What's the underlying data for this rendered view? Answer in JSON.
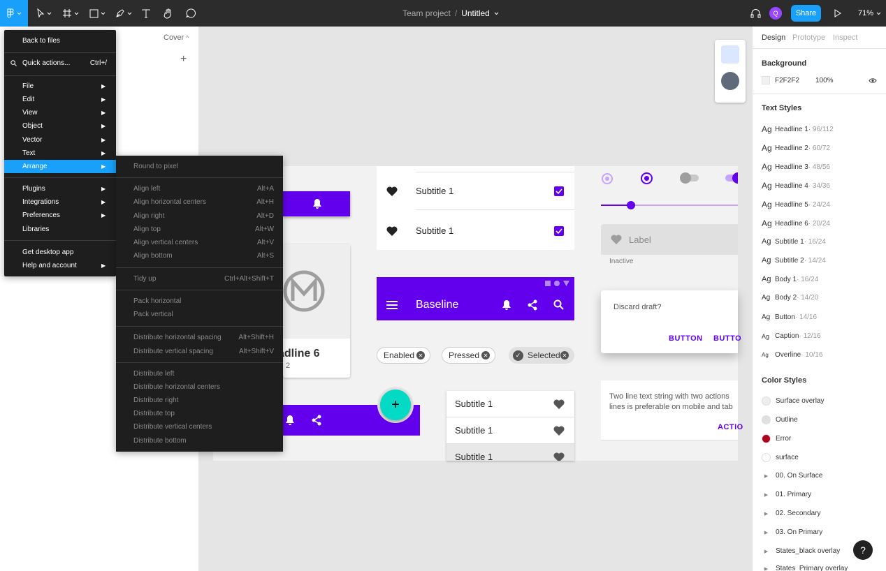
{
  "toolbar": {
    "project": "Team project",
    "separator": "/",
    "file_name": "Untitled",
    "share_label": "Share",
    "avatar_initial": "Q",
    "zoom": "71%",
    "accent": "#18a0fb"
  },
  "left_panel": {
    "page_name": "Cover",
    "add_label": "+"
  },
  "main_menu": {
    "items": [
      {
        "label": "Back to files"
      },
      {
        "label": "Quick actions...",
        "shortcut": "Ctrl+/"
      },
      {
        "label": "File"
      },
      {
        "label": "Edit"
      },
      {
        "label": "View"
      },
      {
        "label": "Object"
      },
      {
        "label": "Vector"
      },
      {
        "label": "Text"
      },
      {
        "label": "Arrange"
      },
      {
        "label": "Plugins"
      },
      {
        "label": "Integrations"
      },
      {
        "label": "Preferences"
      },
      {
        "label": "Libraries"
      },
      {
        "label": "Get desktop app"
      },
      {
        "label": "Help and account"
      }
    ]
  },
  "arrange_menu": {
    "items": [
      {
        "label": "Round to pixel",
        "shortcut": ""
      },
      {
        "label": "Align left",
        "shortcut": "Alt+A"
      },
      {
        "label": "Align horizontal centers",
        "shortcut": "Alt+H"
      },
      {
        "label": "Align right",
        "shortcut": "Alt+D"
      },
      {
        "label": "Align top",
        "shortcut": "Alt+W"
      },
      {
        "label": "Align vertical centers",
        "shortcut": "Alt+V"
      },
      {
        "label": "Align bottom",
        "shortcut": "Alt+S"
      },
      {
        "label": "Tidy up",
        "shortcut": "Ctrl+Alt+Shift+T"
      },
      {
        "label": "Pack horizontal",
        "shortcut": ""
      },
      {
        "label": "Pack vertical",
        "shortcut": ""
      },
      {
        "label": "Distribute horizontal spacing",
        "shortcut": "Alt+Shift+H"
      },
      {
        "label": "Distribute vertical spacing",
        "shortcut": "Alt+Shift+V"
      },
      {
        "label": "Distribute left",
        "shortcut": ""
      },
      {
        "label": "Distribute horizontal centers",
        "shortcut": ""
      },
      {
        "label": "Distribute right",
        "shortcut": ""
      },
      {
        "label": "Distribute top",
        "shortcut": ""
      },
      {
        "label": "Distribute vertical centers",
        "shortcut": ""
      },
      {
        "label": "Distribute bottom",
        "shortcut": ""
      }
    ]
  },
  "canvas": {
    "list_items": [
      "Subtitle 1",
      "Subtitle 1"
    ],
    "slider_level": 0.22,
    "textfield_label": "Label",
    "textfield_helper": "Inactive",
    "card_headline": "adline 6",
    "card_sub": "2",
    "app_bar_title": "Baseline",
    "dialog_text": "Discard draft?",
    "dialog_button_1": "BUTTON",
    "dialog_button_2": "BUTTO",
    "chips": [
      "Enabled",
      "Pressed",
      "Selected"
    ],
    "fab_label": "+",
    "menu_items": [
      "Subtitle 1",
      "Subtitle 1",
      "Subtitle 1"
    ],
    "two_line_1": "Two line text string with two actions",
    "two_line_2": "lines is preferable on mobile and tab",
    "two_line_action": "ACTIO",
    "primary_color": "#6200ee",
    "secondary_color": "#03dac6"
  },
  "right_panel": {
    "tabs": [
      "Design",
      "Prototype",
      "Inspect"
    ],
    "background_heading": "Background",
    "background_hex": "F2F2F2",
    "background_opacity": "100%",
    "text_styles_heading": "Text Styles",
    "ag": "Ag",
    "text_styles": [
      {
        "name": "Headline 1",
        "spec": " · 96/112"
      },
      {
        "name": "Headline 2",
        "spec": " · 60/72"
      },
      {
        "name": "Headline 3",
        "spec": " · 48/56"
      },
      {
        "name": "Headline 4",
        "spec": " · 34/36"
      },
      {
        "name": "Headline 5",
        "spec": " · 24/24"
      },
      {
        "name": "Headline 6",
        "spec": " · 20/24"
      },
      {
        "name": "Subtitle 1",
        "spec": " · 16/24"
      },
      {
        "name": "Subtitle 2",
        "spec": " · 14/24"
      },
      {
        "name": "Body 1",
        "spec": " · 16/24"
      },
      {
        "name": "Body 2",
        "spec": " · 14/20"
      },
      {
        "name": "Button",
        "spec": " · 14/16"
      },
      {
        "name": "Caption",
        "spec": " · 12/16"
      },
      {
        "name": "Overline",
        "spec": " · 10/16"
      }
    ],
    "color_styles_heading": "Color Styles",
    "color_styles": [
      {
        "name": "Surface overlay",
        "color": "#eeeeee"
      },
      {
        "name": "Outline",
        "color": "#e0e0e0"
      },
      {
        "name": "Error",
        "color": "#b00020"
      },
      {
        "name": "surface",
        "color": "#ffffff"
      }
    ],
    "color_groups": [
      "00. On Surface",
      "01. Primary",
      "02. Secondary",
      "03. On Primary",
      "States_black overlay",
      "States_Primary overlay"
    ],
    "help_label": "?"
  }
}
